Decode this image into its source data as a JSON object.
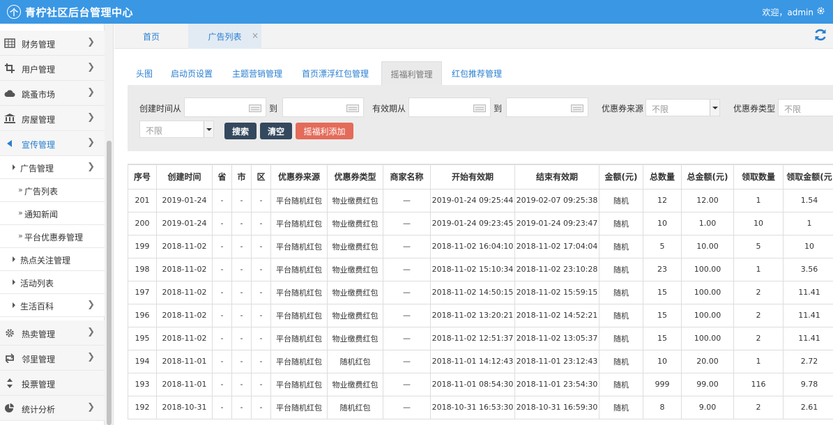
{
  "header": {
    "logo_glyph": "个",
    "title": "青柠社区后台管理中心",
    "welcome": "欢迎，admin"
  },
  "sidebar": {
    "items": [
      {
        "label": "财务管理",
        "icon": "table-icon"
      },
      {
        "label": "用户管理",
        "icon": "crop-icon"
      },
      {
        "label": "跳蚤市场",
        "icon": "cloud-icon"
      },
      {
        "label": "房屋管理",
        "icon": "bank-icon"
      },
      {
        "label": "宣传管理",
        "icon": "volume-icon"
      }
    ],
    "sub": {
      "ad_mgmt": "广告管理",
      "ad_list": "广告列表",
      "notice": "通知新闻",
      "coupon_mgmt": "平台优惠券管理",
      "hot_topics": "热点关注管理",
      "activities": "活动列表",
      "life_wiki": "生活百科"
    },
    "bottom": [
      {
        "label": "热卖管理",
        "icon": "gear-icon"
      },
      {
        "label": "邻里管理",
        "icon": "retweet-icon"
      },
      {
        "label": "投票管理",
        "icon": "sort-icon"
      },
      {
        "label": "统计分析",
        "icon": "pie-chart-icon"
      }
    ]
  },
  "page_tabs": {
    "home": "首页",
    "ad_list": "广告列表",
    "close": "×"
  },
  "sub_tabs": [
    "头图",
    "启动页设置",
    "主题营销管理",
    "首页漂浮红包管理",
    "摇福利管理",
    "红包推荐管理"
  ],
  "filter": {
    "created_from": "创建时间从",
    "to1": "到",
    "valid_from": "有效期从",
    "to2": "到",
    "coupon_source": "优惠券来源",
    "coupon_source_value": "不限",
    "coupon_type": "优惠券类型",
    "coupon_type_placeholder": "不限",
    "third_select_value": "不限",
    "search_btn": "搜索",
    "clear_btn": "清空",
    "add_btn": "摇福利添加"
  },
  "table": {
    "headers": [
      "序号",
      "创建时间",
      "省",
      "市",
      "区",
      "优惠券来源",
      "优惠券类型",
      "商家名称",
      "开始有效期",
      "结束有效期",
      "金额(元)",
      "总数量",
      "总金额(元)",
      "领取数量",
      "领取金额(元"
    ],
    "rows": [
      [
        "201",
        "2019-01-24",
        "-",
        "-",
        "-",
        "平台随机红包",
        "物业缴费红包",
        "—",
        "2019-01-24 09:25:44",
        "2019-02-07 09:25:38",
        "随机",
        "12",
        "12.00",
        "1",
        "1.54"
      ],
      [
        "200",
        "2019-01-24",
        "-",
        "-",
        "-",
        "平台随机红包",
        "物业缴费红包",
        "—",
        "2019-01-24 09:23:45",
        "2019-01-24 09:23:47",
        "随机",
        "10",
        "1.00",
        "10",
        "1"
      ],
      [
        "199",
        "2018-11-02",
        "-",
        "-",
        "-",
        "平台随机红包",
        "物业缴费红包",
        "—",
        "2018-11-02 16:04:10",
        "2018-11-02 17:04:04",
        "随机",
        "5",
        "10.00",
        "5",
        "10"
      ],
      [
        "198",
        "2018-11-02",
        "-",
        "-",
        "-",
        "平台随机红包",
        "物业缴费红包",
        "—",
        "2018-11-02 15:10:34",
        "2018-11-02 23:10:28",
        "随机",
        "23",
        "100.00",
        "1",
        "3.56"
      ],
      [
        "197",
        "2018-11-02",
        "-",
        "-",
        "-",
        "平台随机红包",
        "物业缴费红包",
        "—",
        "2018-11-02 14:50:15",
        "2018-11-02 15:59:15",
        "随机",
        "15",
        "100.00",
        "2",
        "11.41"
      ],
      [
        "196",
        "2018-11-02",
        "-",
        "-",
        "-",
        "平台随机红包",
        "物业缴费红包",
        "—",
        "2018-11-02 13:20:21",
        "2018-11-02 14:52:21",
        "随机",
        "15",
        "100.00",
        "2",
        "11.41"
      ],
      [
        "195",
        "2018-11-02",
        "-",
        "-",
        "-",
        "平台随机红包",
        "物业缴费红包",
        "—",
        "2018-11-02 12:51:37",
        "2018-11-02 13:05:37",
        "随机",
        "15",
        "100.00",
        "2",
        "11.41"
      ],
      [
        "194",
        "2018-11-01",
        "-",
        "-",
        "-",
        "平台随机红包",
        "随机红包",
        "—",
        "2018-11-01 14:12:43",
        "2018-11-01 23:12:43",
        "随机",
        "10",
        "20.00",
        "1",
        "2.72"
      ],
      [
        "193",
        "2018-11-01",
        "-",
        "-",
        "-",
        "平台随机红包",
        "物业缴费红包",
        "—",
        "2018-11-01 08:54:30",
        "2018-11-01 23:54:30",
        "随机",
        "999",
        "99.00",
        "116",
        "9.78"
      ],
      [
        "192",
        "2018-10-31",
        "-",
        "-",
        "-",
        "平台随机红包",
        "随机红包",
        "—",
        "2018-10-31 16:53:30",
        "2018-10-31 16:59:30",
        "随机",
        "8",
        "9.00",
        "2",
        "2.61"
      ]
    ]
  },
  "colors": {
    "topbar": "#3a97e4",
    "link": "#2a7fd0",
    "dark_button": "#34495e",
    "red_button": "#e46b5a"
  }
}
